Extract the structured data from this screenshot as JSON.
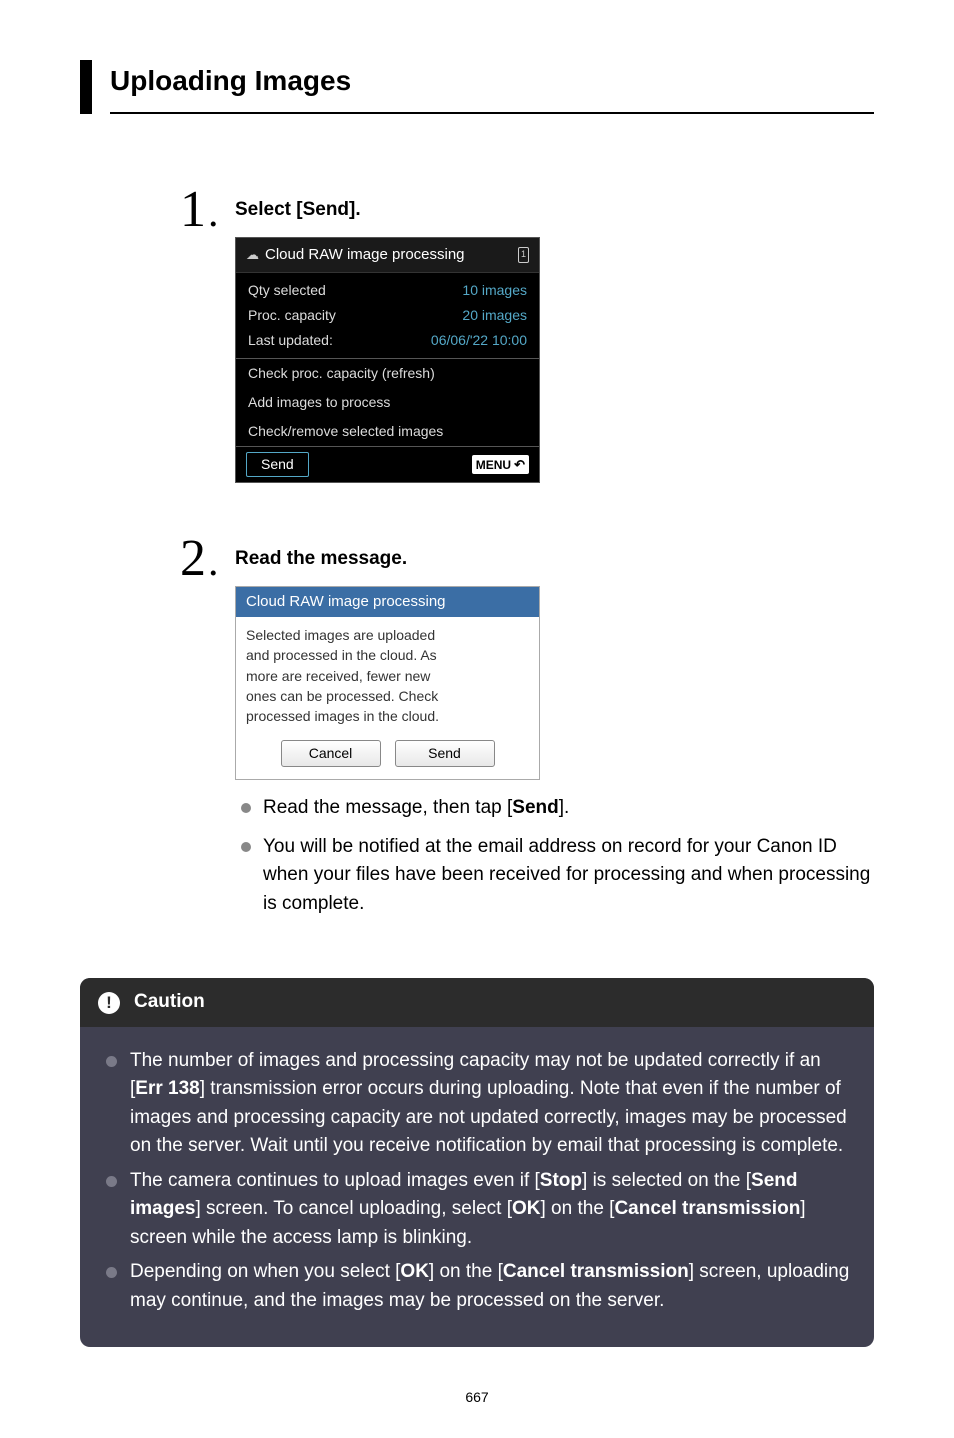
{
  "pageTitle": "Uploading Images",
  "pageNumber": "667",
  "steps": [
    {
      "num": "1",
      "heading": "Select [Send].",
      "camera1": {
        "title": "Cloud RAW image processing",
        "cardLabel": "1",
        "rows": [
          {
            "label": "Qty selected",
            "value": "10 images"
          },
          {
            "label": "Proc. capacity",
            "value": "20 images"
          },
          {
            "label": "Last updated:",
            "value": "06/06/'22 10:00"
          }
        ],
        "items": [
          "Check proc. capacity (refresh)",
          "Add images to process",
          "Check/remove selected images"
        ],
        "sendLabel": "Send",
        "menuLabel": "MENU"
      }
    },
    {
      "num": "2",
      "heading": "Read the message.",
      "camera2": {
        "title": "Cloud RAW image processing",
        "bodyLines": [
          "Selected images are uploaded",
          "and processed in the cloud. As",
          "more are received, fewer new",
          "ones can be processed. Check",
          "processed images in the cloud."
        ],
        "cancelLabel": "Cancel",
        "sendLabel": "Send"
      },
      "bullets": [
        {
          "pre": "Read the message, then tap [",
          "bold1": "Send",
          "post": "]."
        },
        {
          "text": "You will be notified at the email address on record for your Canon ID when your files have been received for processing and when processing is complete."
        }
      ]
    }
  ],
  "caution": {
    "title": "Caution",
    "items": [
      {
        "segments": [
          {
            "t": "The number of images and processing capacity may not be updated correctly if an ["
          },
          {
            "t": "Err 138",
            "b": true
          },
          {
            "t": "] transmission error occurs during uploading. Note that even if the number of images and processing capacity are not updated correctly, images may be processed on the server. Wait until you receive notification by email that processing is complete."
          }
        ]
      },
      {
        "segments": [
          {
            "t": "The camera continues to upload images even if ["
          },
          {
            "t": "Stop",
            "b": true
          },
          {
            "t": "] is selected on the ["
          },
          {
            "t": "Send images",
            "b": true
          },
          {
            "t": "] screen. To cancel uploading, select ["
          },
          {
            "t": "OK",
            "b": true
          },
          {
            "t": "] on the ["
          },
          {
            "t": "Cancel transmission",
            "b": true
          },
          {
            "t": "] screen while the access lamp is blinking."
          }
        ]
      },
      {
        "segments": [
          {
            "t": "Depending on when you select ["
          },
          {
            "t": "OK",
            "b": true
          },
          {
            "t": "] on the ["
          },
          {
            "t": "Cancel transmission",
            "b": true
          },
          {
            "t": "] screen, uploading may continue, and the images may be processed on the server."
          }
        ]
      }
    ]
  }
}
